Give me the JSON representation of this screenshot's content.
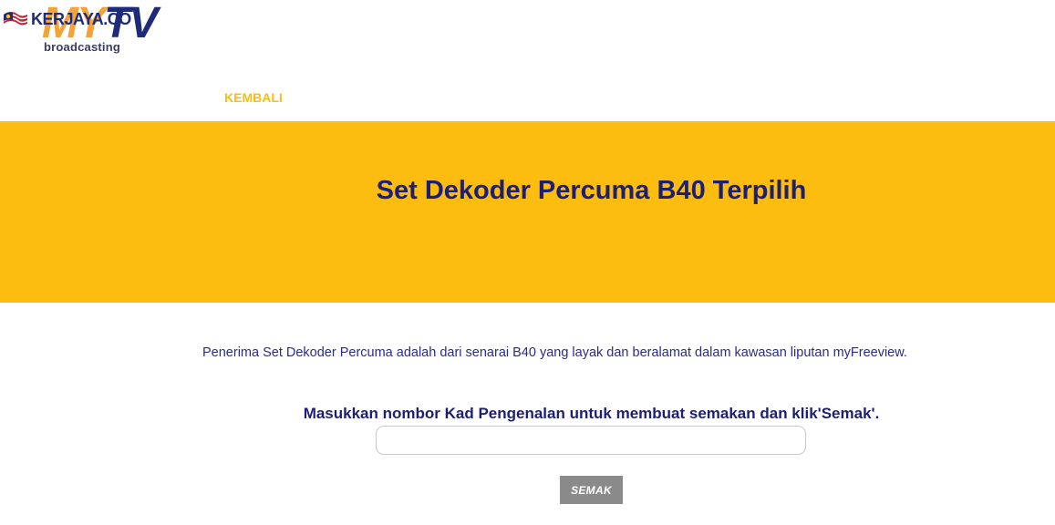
{
  "logo": {
    "brand_my": "MY",
    "brand_tv": "TV",
    "tagline": "broadcasting",
    "watermark_text": "KERJAYA.CO",
    "watermark_icon": "malaysia-flag-icon"
  },
  "nav": {
    "back_label": "KEMBALI"
  },
  "banner": {
    "title": "Set Dekoder Percuma B40 Terpilih",
    "background_color": "#fdbd10"
  },
  "content": {
    "intro": "Penerima Set Dekoder Percuma adalah dari senarai B40 yang layak dan beralamat dalam kawasan liputan myFreeview.",
    "instruction": "Masukkan nombor Kad Pengenalan untuk membuat semakan dan klik'Semak'.",
    "ic_value": "",
    "ic_placeholder": "",
    "submit_label": "SEMAK"
  },
  "colors": {
    "accent_yellow": "#fdbd10",
    "navy": "#1c1f73",
    "button_gray": "#8a8a8a"
  }
}
